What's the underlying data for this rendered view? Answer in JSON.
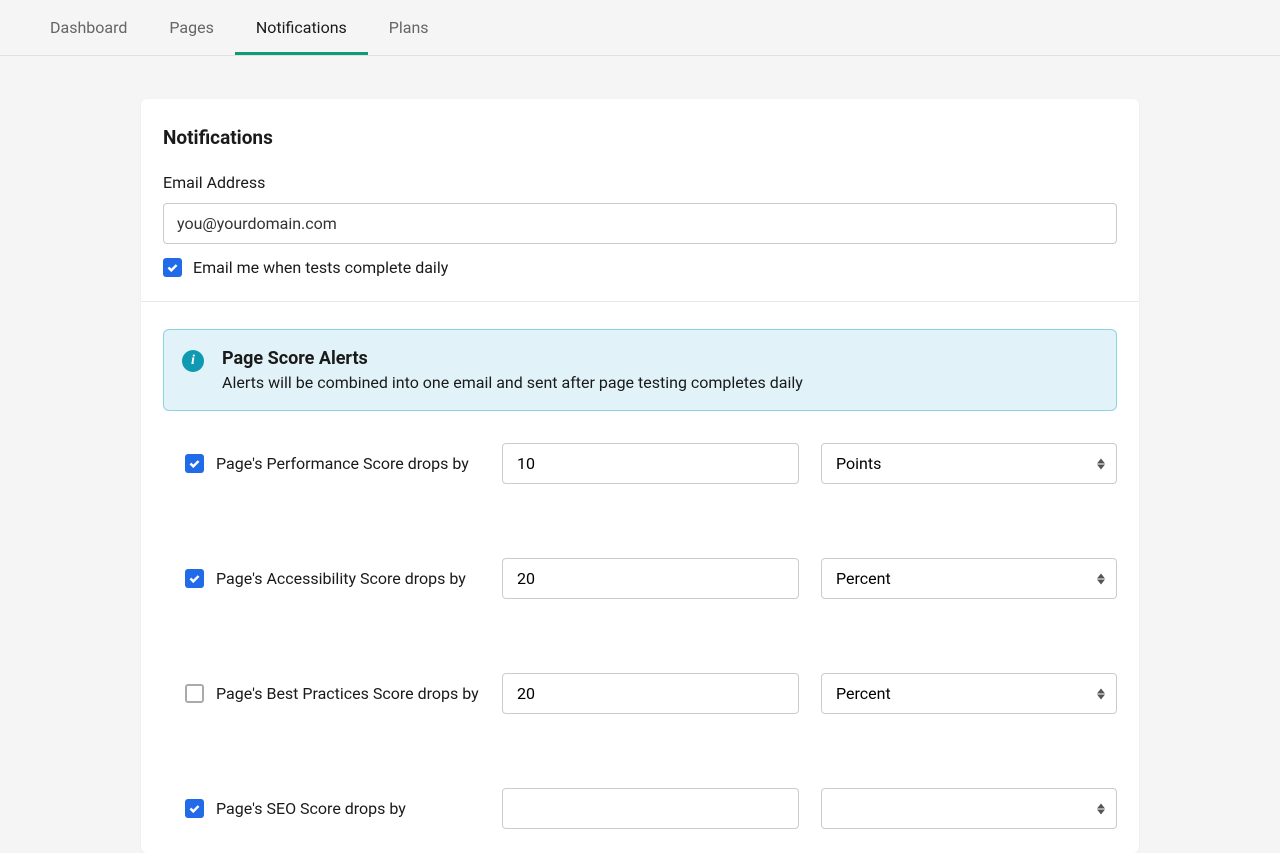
{
  "tabs": [
    {
      "label": "Dashboard",
      "active": false
    },
    {
      "label": "Pages",
      "active": false
    },
    {
      "label": "Notifications",
      "active": true
    },
    {
      "label": "Plans",
      "active": false
    }
  ],
  "page": {
    "title": "Notifications"
  },
  "email": {
    "label": "Email Address",
    "value": "you@yourdomain.com",
    "checkbox_label": "Email me when tests complete daily",
    "checkbox_checked": true
  },
  "info": {
    "title": "Page Score Alerts",
    "desc": "Alerts will be combined into one email and sent after page testing completes daily"
  },
  "unit_options": [
    "Points",
    "Percent"
  ],
  "alerts": [
    {
      "checked": true,
      "label": "Page's Performance Score drops by",
      "value": "10",
      "unit": "Points"
    },
    {
      "checked": true,
      "label": "Page's Accessibility Score drops by",
      "value": "20",
      "unit": "Percent"
    },
    {
      "checked": false,
      "label": "Page's Best Practices Score drops by",
      "value": "20",
      "unit": "Percent"
    },
    {
      "checked": true,
      "label": "Page's SEO Score drops by",
      "value": "",
      "unit": ""
    }
  ]
}
